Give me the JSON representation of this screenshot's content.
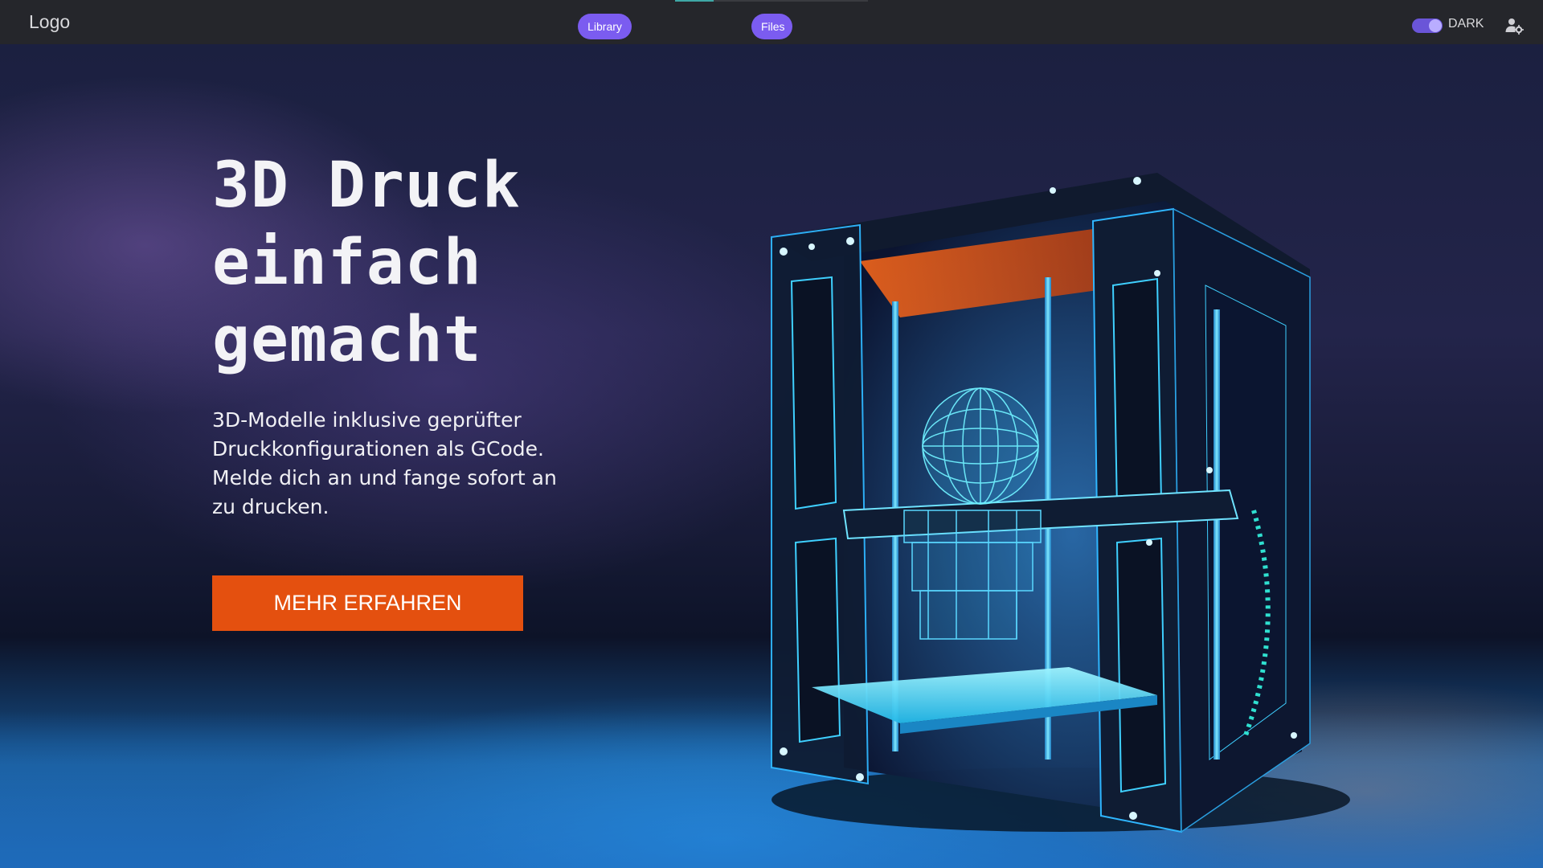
{
  "header": {
    "logo": "Logo",
    "nav": {
      "library_label": "Library",
      "files_label": "Files"
    },
    "theme_toggle": {
      "label": "DARK",
      "on": true
    },
    "user_icon": "user-settings-icon"
  },
  "hero": {
    "headline": [
      "3D Druck",
      "einfach",
      "gemacht"
    ],
    "subtext": "3D-Modelle inklusive geprüfter Druckkonfigurationen als GCode. Melde dich an und fange sofort an zu drucken.",
    "cta_label": "MEHR ERFAHREN",
    "image": "3d-printer-illustration"
  },
  "colors": {
    "topbar": "#25262b",
    "pill": "#7b5cf0",
    "toggle": "#6a55d8",
    "cta": "#e4500f",
    "accent_glow": "#22c8ff"
  }
}
